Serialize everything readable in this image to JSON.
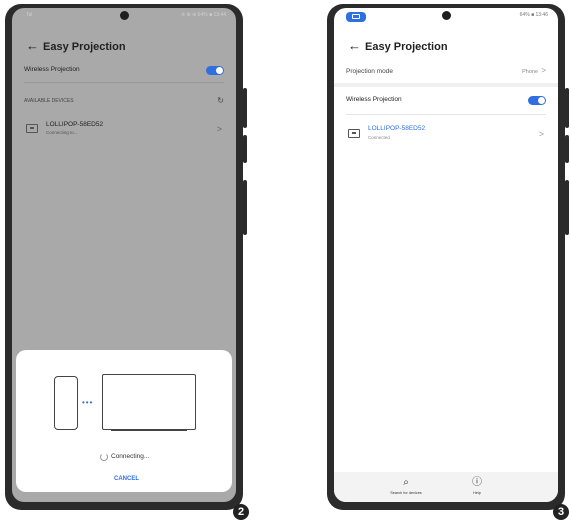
{
  "colors": {
    "accent": "#2f6fdf",
    "phone_frame": "#2b2b2b",
    "dim_screen": "#a9a9a9"
  },
  "screen2": {
    "status_left": "Tal",
    "status_right": "※ ⊕ ⊛ 64% ■ 13:44",
    "title": "Easy Projection",
    "back_icon": "←",
    "wireless_label": "Wireless Projection",
    "available_devices_label": "AVAILABLE DEVICES",
    "refresh_icon": "↻",
    "device": {
      "name": "LOLLIPOP-58ED52",
      "status": "Connecting to...",
      "chevron": ">"
    },
    "dialog": {
      "connecting_text": "Connecting...",
      "cancel_label": "CANCEL",
      "dots": "•••"
    },
    "step_number": "2"
  },
  "screen3": {
    "status_right": "64% ■ 13:46",
    "title": "Easy Projection",
    "back_icon": "←",
    "projection_mode_label": "Projection mode",
    "projection_mode_value": "Phone",
    "chevron": ">",
    "wireless_label": "Wireless Projection",
    "device": {
      "name": "LOLLIPOP-58ED52",
      "status": "Connected",
      "chevron": ">"
    },
    "nav": [
      {
        "icon": "⌕",
        "label": "Search for devices"
      },
      {
        "icon": "ⓘ",
        "label": "Help"
      }
    ],
    "step_number": "3"
  }
}
